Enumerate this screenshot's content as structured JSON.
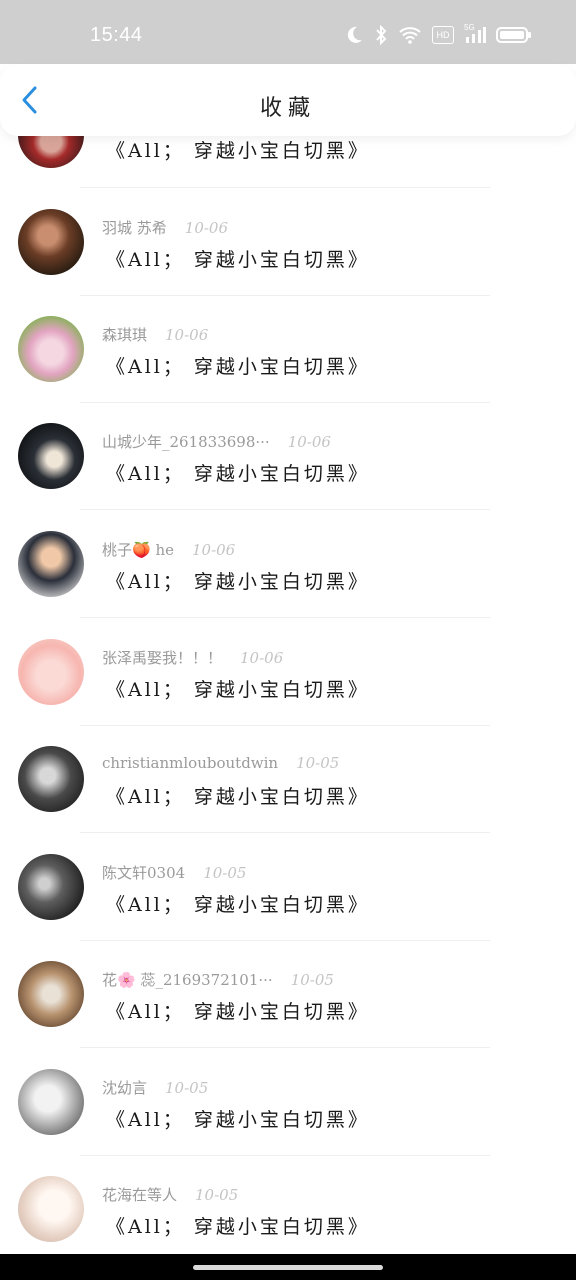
{
  "status_bar": {
    "time": "15:44",
    "icons": [
      "moon-icon",
      "bluetooth-icon",
      "wifi-icon",
      "hd-icon",
      "signal-5g-icon",
      "battery-icon"
    ],
    "hd_label": "HD",
    "network_label": "5G"
  },
  "header": {
    "title": "收藏",
    "back_icon": "chevron-left-icon",
    "accent": "#2a8fe0"
  },
  "items": [
    {
      "user": "",
      "date": "",
      "message": "《All； 穿越小宝白切黑》"
    },
    {
      "user": "羽城 苏希",
      "date": "10-06",
      "message": "《All； 穿越小宝白切黑》"
    },
    {
      "user": "森琪琪",
      "date": "10-06",
      "message": "《All； 穿越小宝白切黑》"
    },
    {
      "user": "山城少年_261833698···",
      "date": "10-06",
      "message": "《All； 穿越小宝白切黑》"
    },
    {
      "user": "桃子🍑 he",
      "date": "10-06",
      "message": "《All； 穿越小宝白切黑》"
    },
    {
      "user": "张泽禹娶我！！！",
      "date": "10-06",
      "message": "《All； 穿越小宝白切黑》"
    },
    {
      "user": "christianmlouboutdwin",
      "date": "10-05",
      "message": "《All； 穿越小宝白切黑》"
    },
    {
      "user": "陈文轩0304",
      "date": "10-05",
      "message": "《All； 穿越小宝白切黑》"
    },
    {
      "user": "花🌸 蕊_2169372101···",
      "date": "10-05",
      "message": "《All； 穿越小宝白切黑》"
    },
    {
      "user": "沈幼言",
      "date": "10-05",
      "message": "《All； 穿越小宝白切黑》"
    },
    {
      "user": "花海在等人",
      "date": "10-05",
      "message": "《All； 穿越小宝白切黑》"
    }
  ]
}
